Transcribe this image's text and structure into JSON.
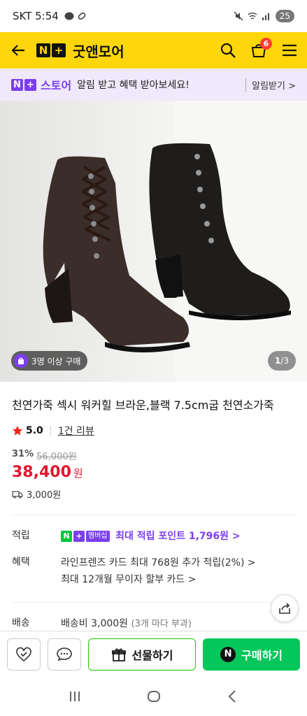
{
  "status_bar": {
    "carrier_time": "SKT 5:54",
    "battery": "25"
  },
  "header": {
    "logo": [
      "N",
      "+"
    ],
    "store_name": "굿앤모어",
    "cart_count": "6"
  },
  "promo": {
    "store_label": "스토어",
    "text": "알림 받고 혜택 받아보세요!",
    "link": "알림받기 >"
  },
  "gallery": {
    "badge": "3명 이상 구매",
    "counter_current": "1",
    "counter_total": "/3"
  },
  "product": {
    "title": "천연가죽 섹시 워커힐 브라운,블랙 7.5cm굽 천연소가죽",
    "rating": "5.0",
    "reviews": "1건 리뷰",
    "discount_pct": "31%",
    "original_price": "56,000원",
    "price": "38,400",
    "price_unit": "원",
    "shipping_fee": "3,000원"
  },
  "details": {
    "points_label": "적립",
    "membership_badge": "멤버십",
    "points_text": "최대 적립 포인트 1,796원 >",
    "benefit_label": "혜택",
    "benefit_1": "라인프렌즈 카드 최대 768원 추가 적립(2%) >",
    "benefit_2": "최대 12개월 무이자 할부 카드 >",
    "delivery_label": "배송",
    "delivery_text": "배송비 3,000원",
    "delivery_note": "(3개 마다 부과)"
  },
  "actions": {
    "gift": "선물하기",
    "buy": "구매하기",
    "buy_logo": "N"
  },
  "colors": {
    "header_bg": "#ffd60a",
    "accent_purple": "#7a3ff0",
    "price_red": "#e0182f",
    "buy_green": "#03c75a"
  }
}
